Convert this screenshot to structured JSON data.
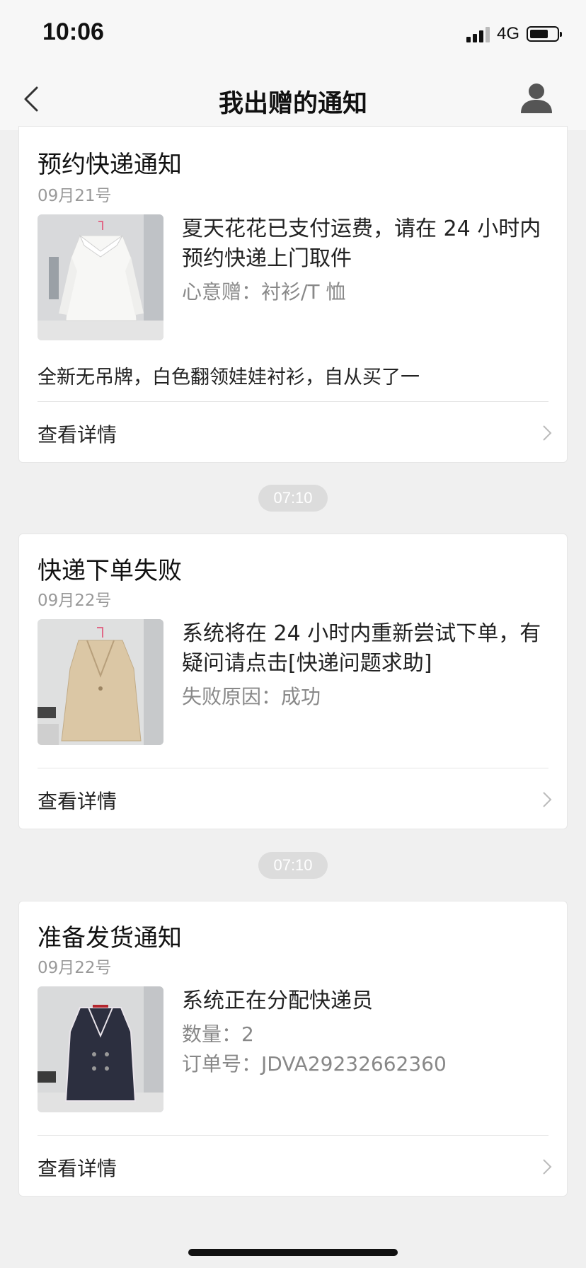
{
  "status_bar": {
    "time": "10:06",
    "network": "4G",
    "battery_percent": 70
  },
  "nav": {
    "title": "我出赠的通知",
    "back_icon": "chevron-left-icon",
    "user_icon": "user-icon"
  },
  "cards": [
    {
      "title": "预约快递通知",
      "date": "09月21号",
      "desc": "夏天花花已支付运费，请在 24 小时内预约快递上门取件",
      "sub1": "心意赠：衬衫/T 恤",
      "note": "全新无吊牌，白色翻领娃娃衬衫，自从买了一",
      "detail": "查看详情",
      "thumb": "white-blouse-photo"
    },
    {
      "title": "快递下单失败",
      "date": "09月22号",
      "desc": "系统将在 24 小时内重新尝试下单，有疑问请点击[快递问题求助]",
      "sub1": "失败原因：成功",
      "detail": "查看详情",
      "thumb": "beige-coat-photo"
    },
    {
      "title": "准备发货通知",
      "date": "09月22号",
      "desc": "系统正在分配快递员",
      "sub1": "数量：2",
      "sub2": "订单号：JDVA29232662360",
      "detail": "查看详情",
      "thumb": "dark-blazer-photo"
    }
  ],
  "time_separators": [
    "07:10",
    "07:10"
  ],
  "colors": {
    "background": "#f0f0f0",
    "card": "#ffffff",
    "pill": "#dcdcdc",
    "secondary_text": "#999999"
  }
}
